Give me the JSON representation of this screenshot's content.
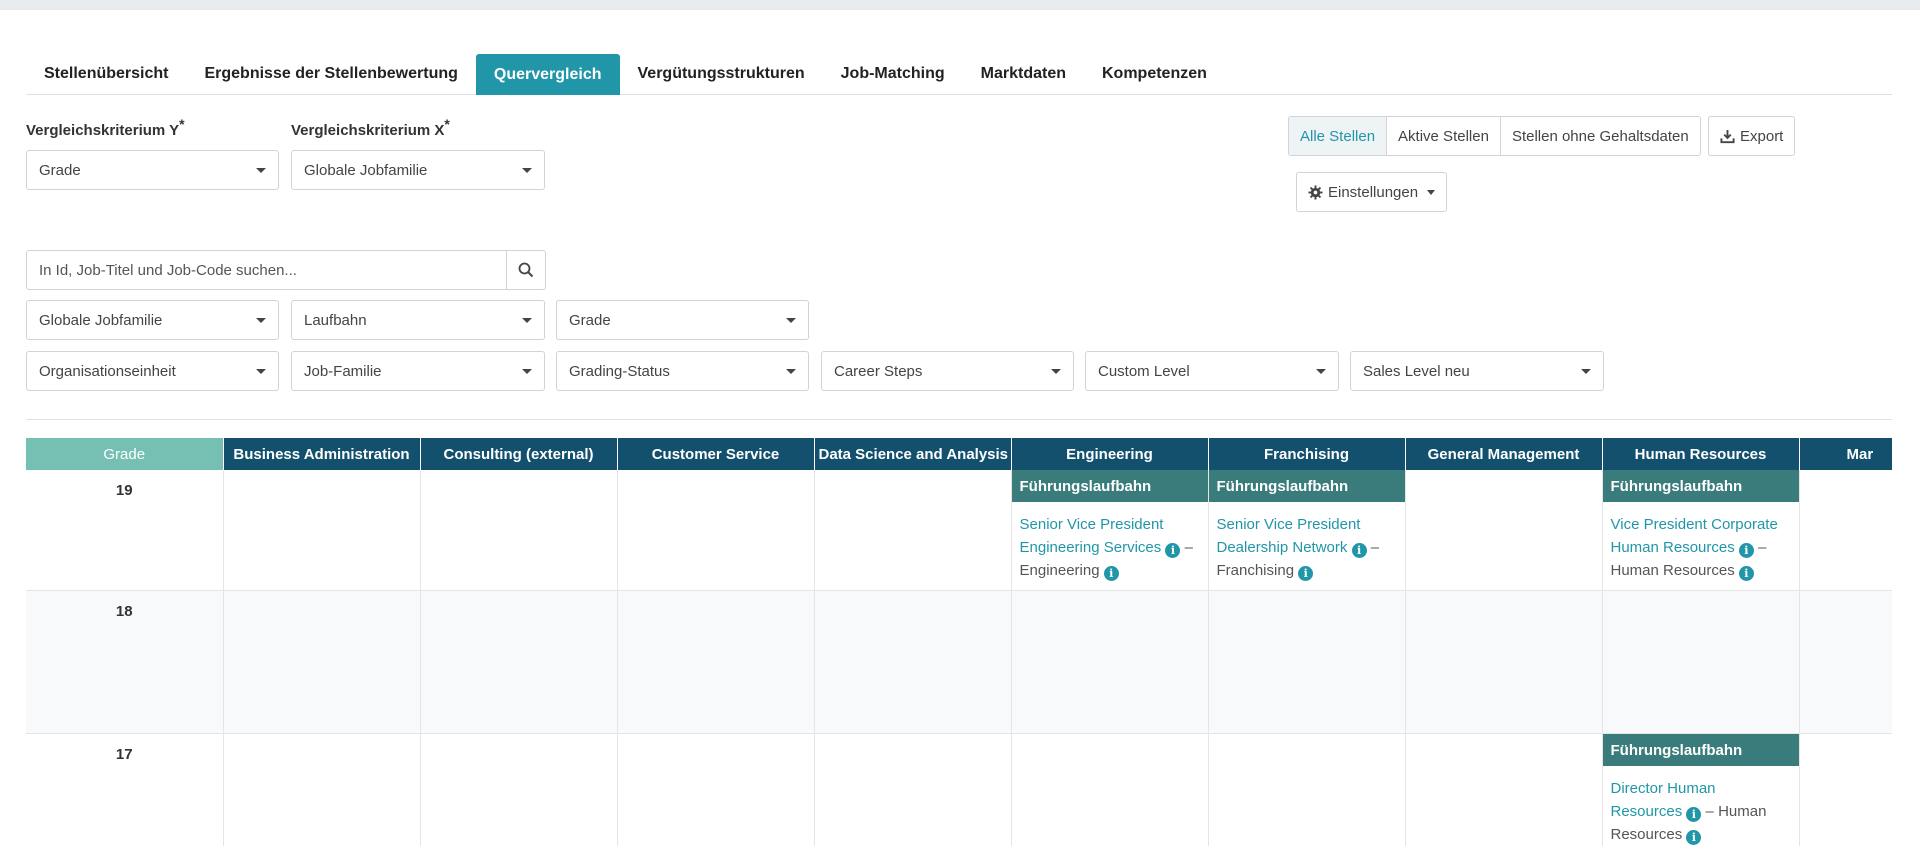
{
  "tabs": [
    {
      "label": "Stellenübersicht"
    },
    {
      "label": "Ergebnisse der Stellenbewertung"
    },
    {
      "label": "Quervergleich"
    },
    {
      "label": "Vergütungsstrukturen"
    },
    {
      "label": "Job-Matching"
    },
    {
      "label": "Marktdaten"
    },
    {
      "label": "Kompetenzen"
    }
  ],
  "active_tab": "Quervergleich",
  "criteria": {
    "y_label": "Vergleichskriterium Y",
    "x_label": "Vergleichskriterium X",
    "required_mark": "*",
    "y_value": "Grade",
    "x_value": "Globale Jobfamilie"
  },
  "view_filter": {
    "options": [
      "Alle Stellen",
      "Aktive Stellen",
      "Stellen ohne Gehaltsdaten"
    ],
    "selected": "Alle Stellen"
  },
  "export_label": "Export",
  "settings_label": "Einstellungen",
  "search": {
    "placeholder": "In Id, Job-Titel und Job-Code suchen...",
    "value": ""
  },
  "filters_row1": [
    "Globale Jobfamilie",
    "Laufbahn",
    "Grade"
  ],
  "filters_row2": [
    "Organisationseinheit",
    "Job-Familie",
    "Grading-Status",
    "Career Steps",
    "Custom Level",
    "Sales Level neu"
  ],
  "grid": {
    "grade_header": "Grade",
    "columns": [
      "Business Administration",
      "Consulting (external)",
      "Customer Service",
      "Data Science and Analysis",
      "Engineering",
      "Franchising",
      "General Management",
      "Human Resources",
      "Mar"
    ],
    "career_label": "Führungslaufbahn",
    "separator": "–",
    "rows": [
      {
        "grade": "19",
        "cells": {
          "4": {
            "career": "Führungslaufbahn",
            "job": "Senior Vice President Engineering Services",
            "family": "Engineering"
          },
          "5": {
            "career": "Führungslaufbahn",
            "job": "Senior Vice President Dealership Network",
            "family": "Franchising"
          },
          "7": {
            "career": "Führungslaufbahn",
            "job": "Vice President Corporate Human Resources",
            "family": "Human Resources"
          }
        }
      },
      {
        "grade": "18",
        "cells": {}
      },
      {
        "grade": "17",
        "cells": {
          "7": {
            "career": "Führungslaufbahn",
            "job": "Director Human Resources",
            "family": "Human Resources"
          }
        }
      }
    ]
  }
}
